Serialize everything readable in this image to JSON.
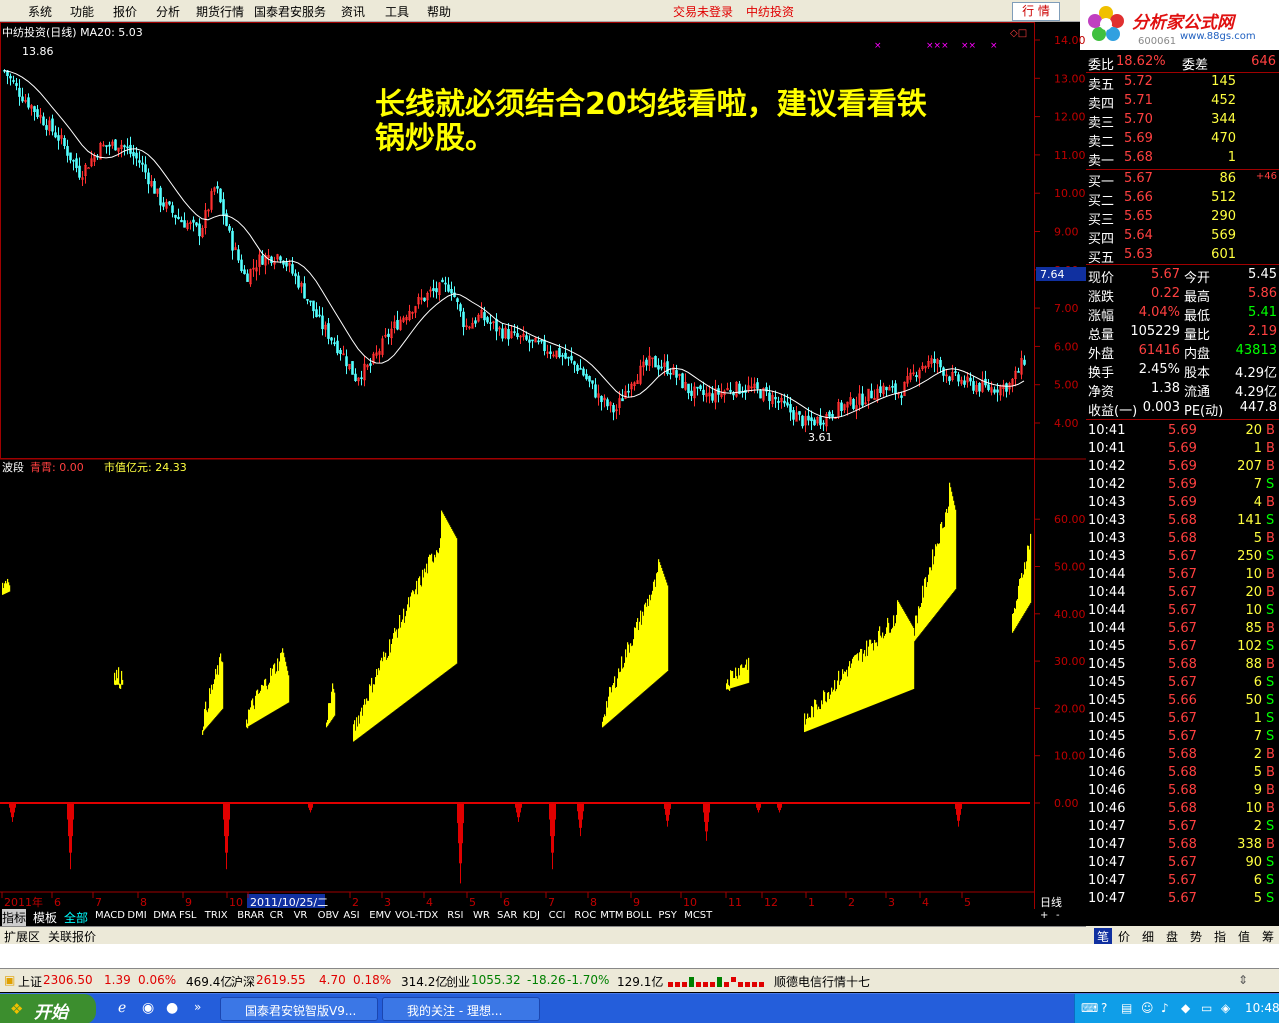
{
  "menubar": {
    "items": [
      "系统",
      "功能",
      "报价",
      "分析",
      "期货行情",
      "国泰君安服务",
      "资讯",
      "工具",
      "帮助"
    ],
    "login_status": "交易未登录",
    "stock_name_red": "中纺投资",
    "quote_button": "行 情"
  },
  "logo": {
    "text": "分析家公式网",
    "url": "www.88gs.com",
    "code_partial": "600061"
  },
  "chart": {
    "title": "中纺投资(日线) MA20: 5.03",
    "high_label": "13.86",
    "low_label": "3.61",
    "current_price_tag": "7.64",
    "price_axis": [
      "14.00",
      "13.00",
      "12.00",
      "11.00",
      "10.00",
      "9.00",
      "8.00",
      "7.00",
      "6.00",
      "5.00",
      "4.00"
    ],
    "indicator_title": "波段",
    "indicator_label1": "青霄: 0.00",
    "indicator_label2": "市值亿元: 24.33",
    "indicator_axis": [
      "60.00",
      "50.00",
      "40.00",
      "30.00",
      "20.00",
      "10.00",
      "0.00"
    ],
    "date_axis": [
      "2011年",
      "6",
      "7",
      "8",
      "9",
      "10",
      "2011/10/25/二",
      "2",
      "3",
      "4",
      "5",
      "6",
      "7",
      "8",
      "9",
      "10",
      "11",
      "12",
      "1",
      "2",
      "3",
      "4",
      "5"
    ],
    "period_label": "日线"
  },
  "annotation": "长线就必须结合20均线看啦，建议看看铁锅炒股。",
  "order_book": {
    "committee_ratio_label": "委比",
    "committee_ratio": "18.62%",
    "committee_diff_label": "委差",
    "committee_diff": "646",
    "asks": [
      {
        "label": "卖五",
        "price": "5.72",
        "vol": "145"
      },
      {
        "label": "卖四",
        "price": "5.71",
        "vol": "452"
      },
      {
        "label": "卖三",
        "price": "5.70",
        "vol": "344"
      },
      {
        "label": "卖二",
        "price": "5.69",
        "vol": "470"
      },
      {
        "label": "卖一",
        "price": "5.68",
        "vol": "1"
      }
    ],
    "bids": [
      {
        "label": "买一",
        "price": "5.67",
        "vol": "86",
        "chg": "+46"
      },
      {
        "label": "买二",
        "price": "5.66",
        "vol": "512",
        "chg": ""
      },
      {
        "label": "买三",
        "price": "5.65",
        "vol": "290",
        "chg": ""
      },
      {
        "label": "买四",
        "price": "5.64",
        "vol": "569",
        "chg": ""
      },
      {
        "label": "买五",
        "price": "5.63",
        "vol": "601",
        "chg": ""
      }
    ]
  },
  "stats": [
    {
      "l1": "现价",
      "v1": "5.67",
      "l2": "今开",
      "v2": "5.45",
      "c1": "#ff4040",
      "c2": "#ffffff"
    },
    {
      "l1": "涨跌",
      "v1": "0.22",
      "l2": "最高",
      "v2": "5.86",
      "c1": "#ff4040",
      "c2": "#ff4040"
    },
    {
      "l1": "涨幅",
      "v1": "4.04%",
      "l2": "最低",
      "v2": "5.41",
      "c1": "#ff4040",
      "c2": "#00ff00"
    },
    {
      "l1": "总量",
      "v1": "105229",
      "l2": "量比",
      "v2": "2.19",
      "c1": "#ffffff",
      "c2": "#ff4040"
    },
    {
      "l1": "外盘",
      "v1": "61416",
      "l2": "内盘",
      "v2": "43813",
      "c1": "#ff4040",
      "c2": "#00ff00"
    },
    {
      "l1": "换手",
      "v1": "2.45%",
      "l2": "股本",
      "v2": "4.29亿",
      "c1": "#ffffff",
      "c2": "#ffffff"
    },
    {
      "l1": "净资",
      "v1": "1.38",
      "l2": "流通",
      "v2": "4.29亿",
      "c1": "#ffffff",
      "c2": "#ffffff"
    },
    {
      "l1": "收益(一)",
      "v1": "0.003",
      "l2": "PE(动)",
      "v2": "447.8",
      "c1": "#ffffff",
      "c2": "#ffffff"
    }
  ],
  "ticks": [
    {
      "t": "10:41",
      "p": "5.69",
      "v": "20",
      "s": "B"
    },
    {
      "t": "10:41",
      "p": "5.69",
      "v": "1",
      "s": "B"
    },
    {
      "t": "10:42",
      "p": "5.69",
      "v": "207",
      "s": "B"
    },
    {
      "t": "10:42",
      "p": "5.69",
      "v": "7",
      "s": "S"
    },
    {
      "t": "10:43",
      "p": "5.69",
      "v": "4",
      "s": "B"
    },
    {
      "t": "10:43",
      "p": "5.68",
      "v": "141",
      "s": "S"
    },
    {
      "t": "10:43",
      "p": "5.68",
      "v": "5",
      "s": "B"
    },
    {
      "t": "10:43",
      "p": "5.67",
      "v": "250",
      "s": "S"
    },
    {
      "t": "10:44",
      "p": "5.67",
      "v": "10",
      "s": "B"
    },
    {
      "t": "10:44",
      "p": "5.67",
      "v": "20",
      "s": "B"
    },
    {
      "t": "10:44",
      "p": "5.67",
      "v": "10",
      "s": "S"
    },
    {
      "t": "10:44",
      "p": "5.67",
      "v": "85",
      "s": "B"
    },
    {
      "t": "10:45",
      "p": "5.67",
      "v": "102",
      "s": "S"
    },
    {
      "t": "10:45",
      "p": "5.68",
      "v": "88",
      "s": "B"
    },
    {
      "t": "10:45",
      "p": "5.67",
      "v": "6",
      "s": "S"
    },
    {
      "t": "10:45",
      "p": "5.66",
      "v": "50",
      "s": "S"
    },
    {
      "t": "10:45",
      "p": "5.67",
      "v": "1",
      "s": "S"
    },
    {
      "t": "10:45",
      "p": "5.67",
      "v": "7",
      "s": "S"
    },
    {
      "t": "10:46",
      "p": "5.68",
      "v": "2",
      "s": "B"
    },
    {
      "t": "10:46",
      "p": "5.68",
      "v": "5",
      "s": "B"
    },
    {
      "t": "10:46",
      "p": "5.68",
      "v": "9",
      "s": "B"
    },
    {
      "t": "10:46",
      "p": "5.68",
      "v": "10",
      "s": "B"
    },
    {
      "t": "10:47",
      "p": "5.67",
      "v": "2",
      "s": "S"
    },
    {
      "t": "10:47",
      "p": "5.68",
      "v": "338",
      "s": "B"
    },
    {
      "t": "10:47",
      "p": "5.67",
      "v": "90",
      "s": "S"
    },
    {
      "t": "10:47",
      "p": "5.67",
      "v": "6",
      "s": "S"
    },
    {
      "t": "10:47",
      "p": "5.67",
      "v": "5",
      "s": "S"
    }
  ],
  "indicator_tabs": [
    "指标",
    "模板",
    "全部",
    "MACD",
    "DMI",
    "DMA",
    "FSL",
    "TRIX",
    "BRAR",
    "CR",
    "VR",
    "OBV",
    "ASI",
    "EMV",
    "VOL-TDX",
    "RSI",
    "WR",
    "SAR",
    "KDJ",
    "CCI",
    "ROC",
    "MTM",
    "BOLL",
    "PSY",
    "MCST"
  ],
  "bottom_tabs": [
    "扩展区",
    "关联报价"
  ],
  "rp_tabs": [
    "笔",
    "价",
    "细",
    "盘",
    "势",
    "指",
    "值",
    "筹"
  ],
  "status_bar": {
    "sh_label": "上证",
    "sh_val": "2306.50",
    "sh_chg": "1.39",
    "sh_pct": "0.06%",
    "sh_amt": "469.4亿",
    "sz_label": "沪深",
    "sz_val": "2619.55",
    "sz_chg": "4.70",
    "sz_pct": "0.18%",
    "sz_amt": "314.2亿",
    "cy_label": "创业",
    "cy_val": "1055.32",
    "cy_chg": "-18.26",
    "cy_pct": "-1.70%",
    "cy_amt": "129.1亿",
    "news": "顺德电信行情十七"
  },
  "taskbar": {
    "start": "开始",
    "tasks": [
      "国泰君安锐智版V9...",
      "我的关注 - 理想..."
    ],
    "clock": "10:48"
  }
}
